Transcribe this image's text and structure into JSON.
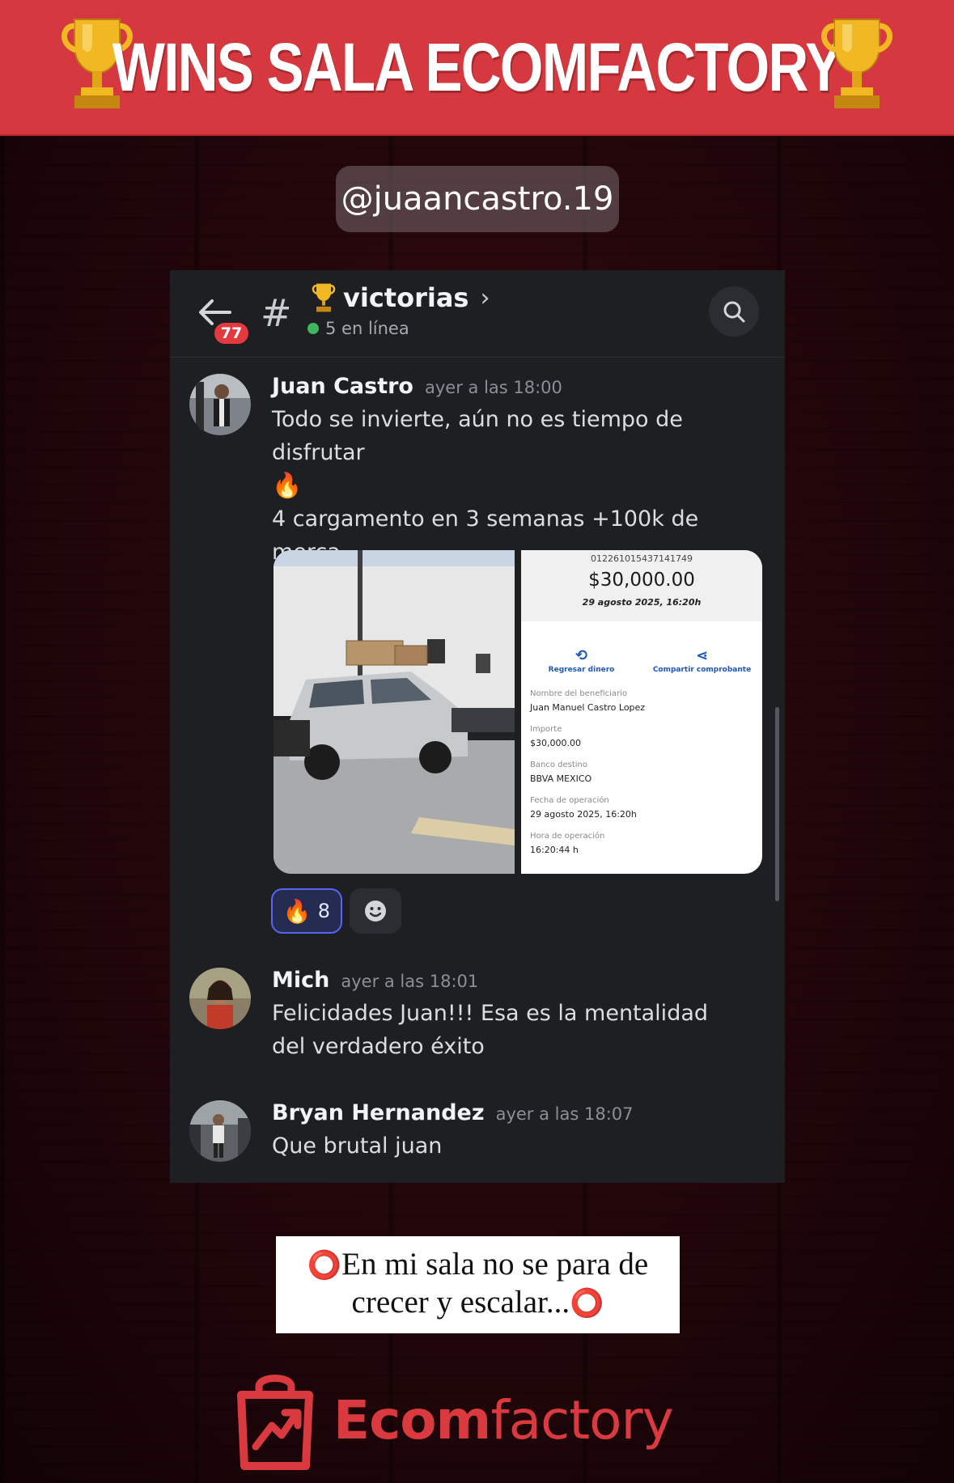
{
  "banner": {
    "title": "WINS SALA ECOMFACTORY"
  },
  "handle": "@juaancastro.19",
  "chat": {
    "unread_badge": "77",
    "channel_name": "victorias",
    "online_status": "5 en línea",
    "messages": [
      {
        "author": "Juan Castro",
        "time": "ayer a las 18:00",
        "line1": "Todo se invierte, aún no es tiempo de disfrutar",
        "emoji1": "🔥",
        "line2": "4 cargamento en 3 semanas +100k de merca",
        "emoji2": "🚀"
      },
      {
        "author": "Mich",
        "time": "ayer a las 18:01",
        "text": "Felicidades Juan!!! Esa es la mentalidad del verdadero éxito"
      },
      {
        "author": "Bryan Hernandez",
        "time": "ayer a las 18:07",
        "text": "Que brutal juan"
      }
    ],
    "reaction": {
      "emoji": "🔥",
      "count": "8"
    }
  },
  "receipt": {
    "reference": "012261015437141749",
    "amount": "$30,000.00",
    "date": "29 agosto 2025, 16:20h",
    "action_left": "Regresar dinero",
    "action_right": "Compartir comprobante",
    "fields": [
      {
        "label": "Nombre del beneficiario",
        "value": "Juan Manuel Castro Lopez"
      },
      {
        "label": "Importe",
        "value": "$30,000.00"
      },
      {
        "label": "Banco destino",
        "value": "BBVA MEXICO"
      },
      {
        "label": "Fecha de operación",
        "value": "29 agosto 2025, 16:20h"
      },
      {
        "label": "Hora de operación",
        "value": "16:20:44 h"
      }
    ]
  },
  "caption": {
    "line1": "En mi sala no se para de",
    "line2": "crecer y escalar..."
  },
  "logo": {
    "text_bold": "Ecom",
    "text_light": "factory"
  },
  "colors": {
    "banner_red": "#d6383f",
    "panel_bg": "#1e1f23",
    "online_green": "#3fb65f",
    "brand_red": "#d83a3f",
    "reaction_blue": "#5865f2"
  }
}
